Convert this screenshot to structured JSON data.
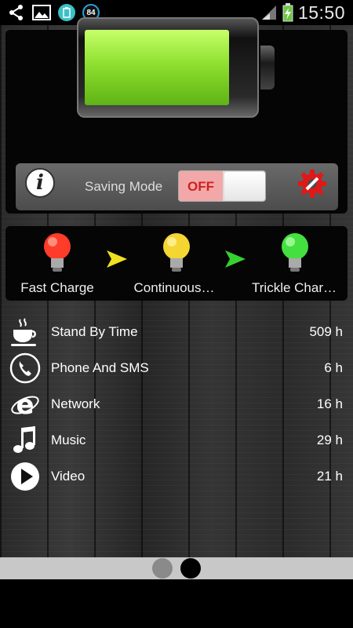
{
  "status_bar": {
    "time": "15:50",
    "notification_count": "84",
    "icons": [
      "share-icon",
      "gallery-icon",
      "battery-app-icon",
      "notification-count-badge",
      "signal-icon",
      "battery-charging-icon"
    ]
  },
  "battery": {
    "level_fraction": 0.85,
    "fill_color": "#8fe030"
  },
  "controls": {
    "saving_mode_label": "Saving Mode",
    "toggle_state": "OFF",
    "info_symbol": "i"
  },
  "stages": [
    {
      "label": "Fast Charge",
      "color": "#ff3b2a"
    },
    {
      "label": "Continuous…",
      "color": "#f5d531"
    },
    {
      "label": "Trickle Char…",
      "color": "#44e040"
    }
  ],
  "usage": [
    {
      "label": "Stand By Time",
      "value": "509 h",
      "icon": "coffee-cup-icon"
    },
    {
      "label": "Phone And SMS",
      "value": "6 h",
      "icon": "phone-icon"
    },
    {
      "label": "Network",
      "value": "16 h",
      "icon": "internet-explorer-icon"
    },
    {
      "label": "Music",
      "value": "29 h",
      "icon": "music-note-icon"
    },
    {
      "label": "Video",
      "value": "21 h",
      "icon": "play-icon"
    }
  ],
  "pager": {
    "total": 2,
    "active": 1
  }
}
